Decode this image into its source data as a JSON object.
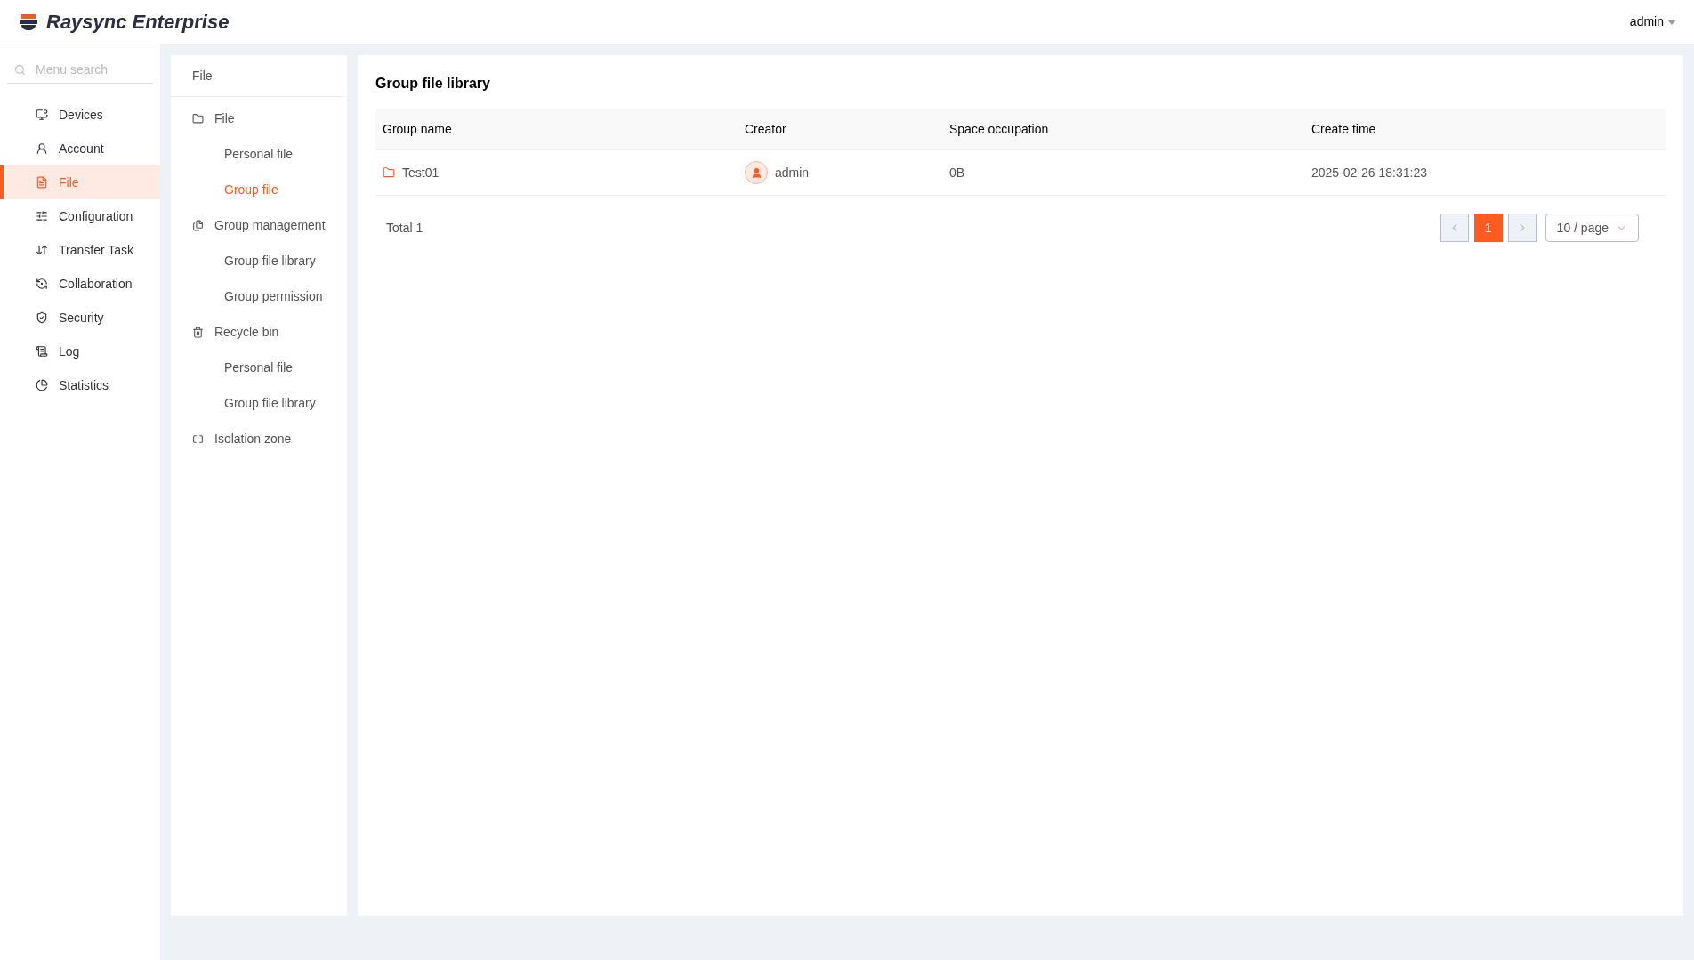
{
  "header": {
    "brand": "Raysync Enterprise",
    "user": "admin"
  },
  "sidebar": {
    "search": {
      "placeholder": "Menu search"
    },
    "items": [
      {
        "label": "Devices",
        "selected": false
      },
      {
        "label": "Account",
        "selected": false
      },
      {
        "label": "File",
        "selected": true
      },
      {
        "label": "Configuration",
        "selected": false
      },
      {
        "label": "Transfer Task",
        "selected": false
      },
      {
        "label": "Collaboration",
        "selected": false
      },
      {
        "label": "Security",
        "selected": false
      },
      {
        "label": "Log",
        "selected": false
      },
      {
        "label": "Statistics",
        "selected": false
      }
    ]
  },
  "subnav": {
    "title": "File",
    "groups": [
      {
        "label": "File",
        "children": [
          {
            "label": "Personal file",
            "selected": false
          },
          {
            "label": "Group file",
            "selected": true
          }
        ]
      },
      {
        "label": "Group management",
        "children": [
          {
            "label": "Group file library",
            "selected": false
          },
          {
            "label": "Group permission",
            "selected": false
          }
        ]
      },
      {
        "label": "Recycle bin",
        "children": [
          {
            "label": "Personal file",
            "selected": false
          },
          {
            "label": "Group file library",
            "selected": false
          }
        ]
      },
      {
        "label": "Isolation zone"
      }
    ]
  },
  "content": {
    "title": "Group file library",
    "table": {
      "columns": [
        "Group name",
        "Creator",
        "Space occupation",
        "Create time"
      ],
      "rows": [
        {
          "group_name": "Test01",
          "creator": "admin",
          "space": "0B",
          "create_time": "2025-02-26 18:31:23"
        }
      ]
    },
    "pagination": {
      "total": "Total 1",
      "pages": [
        {
          "label": "1",
          "selected": true
        }
      ],
      "page_size": "10 / page"
    }
  }
}
